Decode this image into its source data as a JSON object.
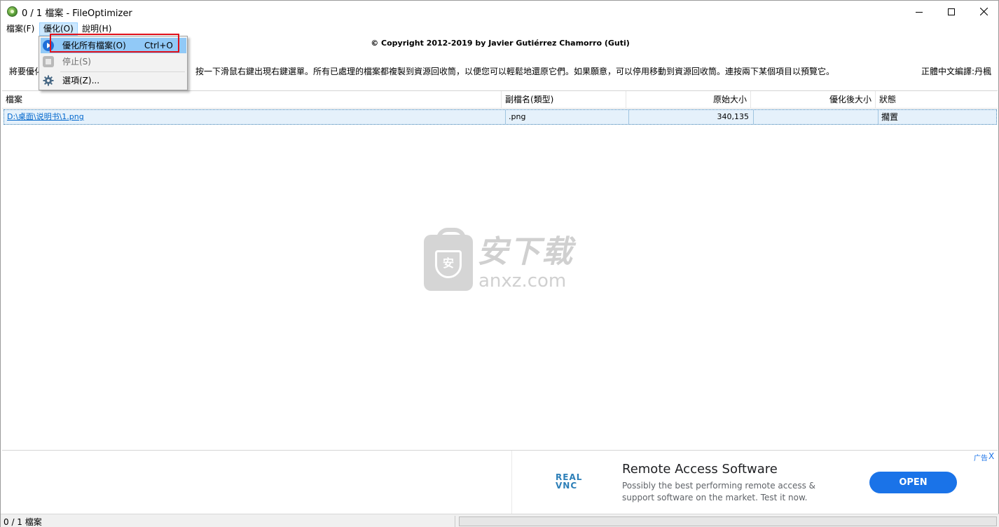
{
  "window": {
    "title": "0 / 1 檔案 - FileOptimizer",
    "icon": "fileoptimizer-app-icon"
  },
  "menubar": {
    "file": "檔案(F)",
    "optimize": "優化(O)",
    "help": "說明(H)"
  },
  "dropdown": {
    "optimize_all": "優化所有檔案(O)",
    "optimize_all_shortcut": "Ctrl+O",
    "stop": "停止(S)",
    "options": "選項(Z)..."
  },
  "header": {
    "copyright": "© Copyright 2012-2019 by Javier Gutiérrez Chamorro (Guti)",
    "info_left_prefix": "將要優化",
    "info_left": "按一下滑鼠右鍵出現右鍵選單。所有已處理的檔案都複製到資源回收筒，以便您可以輕鬆地還原它們。如果願意，可以停用移動到資源回收筒。連按兩下某個項目以預覽它。",
    "info_right": "正體中文編譯:丹楓"
  },
  "table": {
    "columns": [
      "檔案",
      "副檔名(類型)",
      "原始大小",
      "優化後大小",
      "狀態"
    ],
    "rows": [
      {
        "file": "D:\\桌面\\说明书\\1.png",
        "ext": ".png",
        "original_size": "340,135",
        "optimized_size": "",
        "status": "擱置"
      }
    ]
  },
  "watermark": {
    "cn": "安下载",
    "en": "anxz.com",
    "shield_char": "安"
  },
  "ad": {
    "logo": "REAL VNC",
    "title": "Remote Access Software",
    "description": "Possibly the best performing remote access & support software on the market. Test it now.",
    "button": "OPEN",
    "badge": "广告",
    "close": "X"
  },
  "statusbar": {
    "text": "0 / 1 檔案",
    "progress": 0
  },
  "colors": {
    "menu_highlight": "#cce8ff",
    "dropdown_highlight": "#91c9f7",
    "annotation_red": "#e0101a",
    "row_selected": "#e5f1fb",
    "ad_button": "#1a73e8"
  }
}
